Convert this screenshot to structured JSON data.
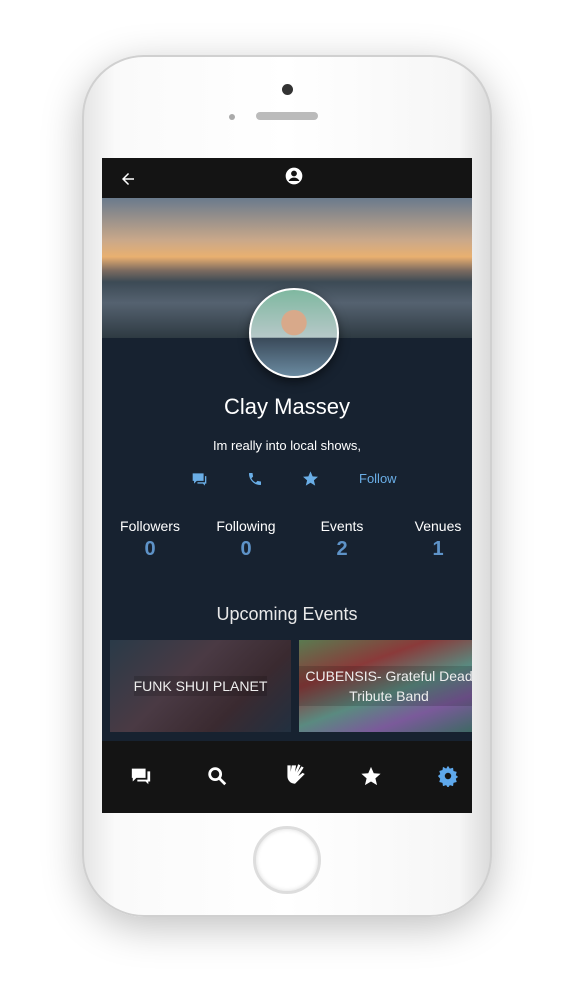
{
  "profile": {
    "name": "Clay Massey",
    "bio": "Im really into local shows,"
  },
  "actions": {
    "message_icon": "message-icon",
    "phone_icon": "phone-icon",
    "star_icon": "star-icon",
    "follow_label": "Follow"
  },
  "stats": [
    {
      "label": "Followers",
      "value": "0"
    },
    {
      "label": "Following",
      "value": "0"
    },
    {
      "label": "Events",
      "value": "2"
    },
    {
      "label": "Venues",
      "value": "1"
    }
  ],
  "upcoming": {
    "title": "Upcoming Events",
    "events": [
      {
        "title": "FUNK SHUI PLANET"
      },
      {
        "title": "CUBENSIS- Grateful Dead Tribute Band"
      }
    ]
  },
  "nav": [
    "chat-icon",
    "search-icon",
    "hand-icon",
    "star-icon",
    "gear-icon"
  ],
  "colors": {
    "accent": "#6aaee6",
    "stat_value": "#5e93c8",
    "background": "#172230",
    "bar": "#141414"
  }
}
